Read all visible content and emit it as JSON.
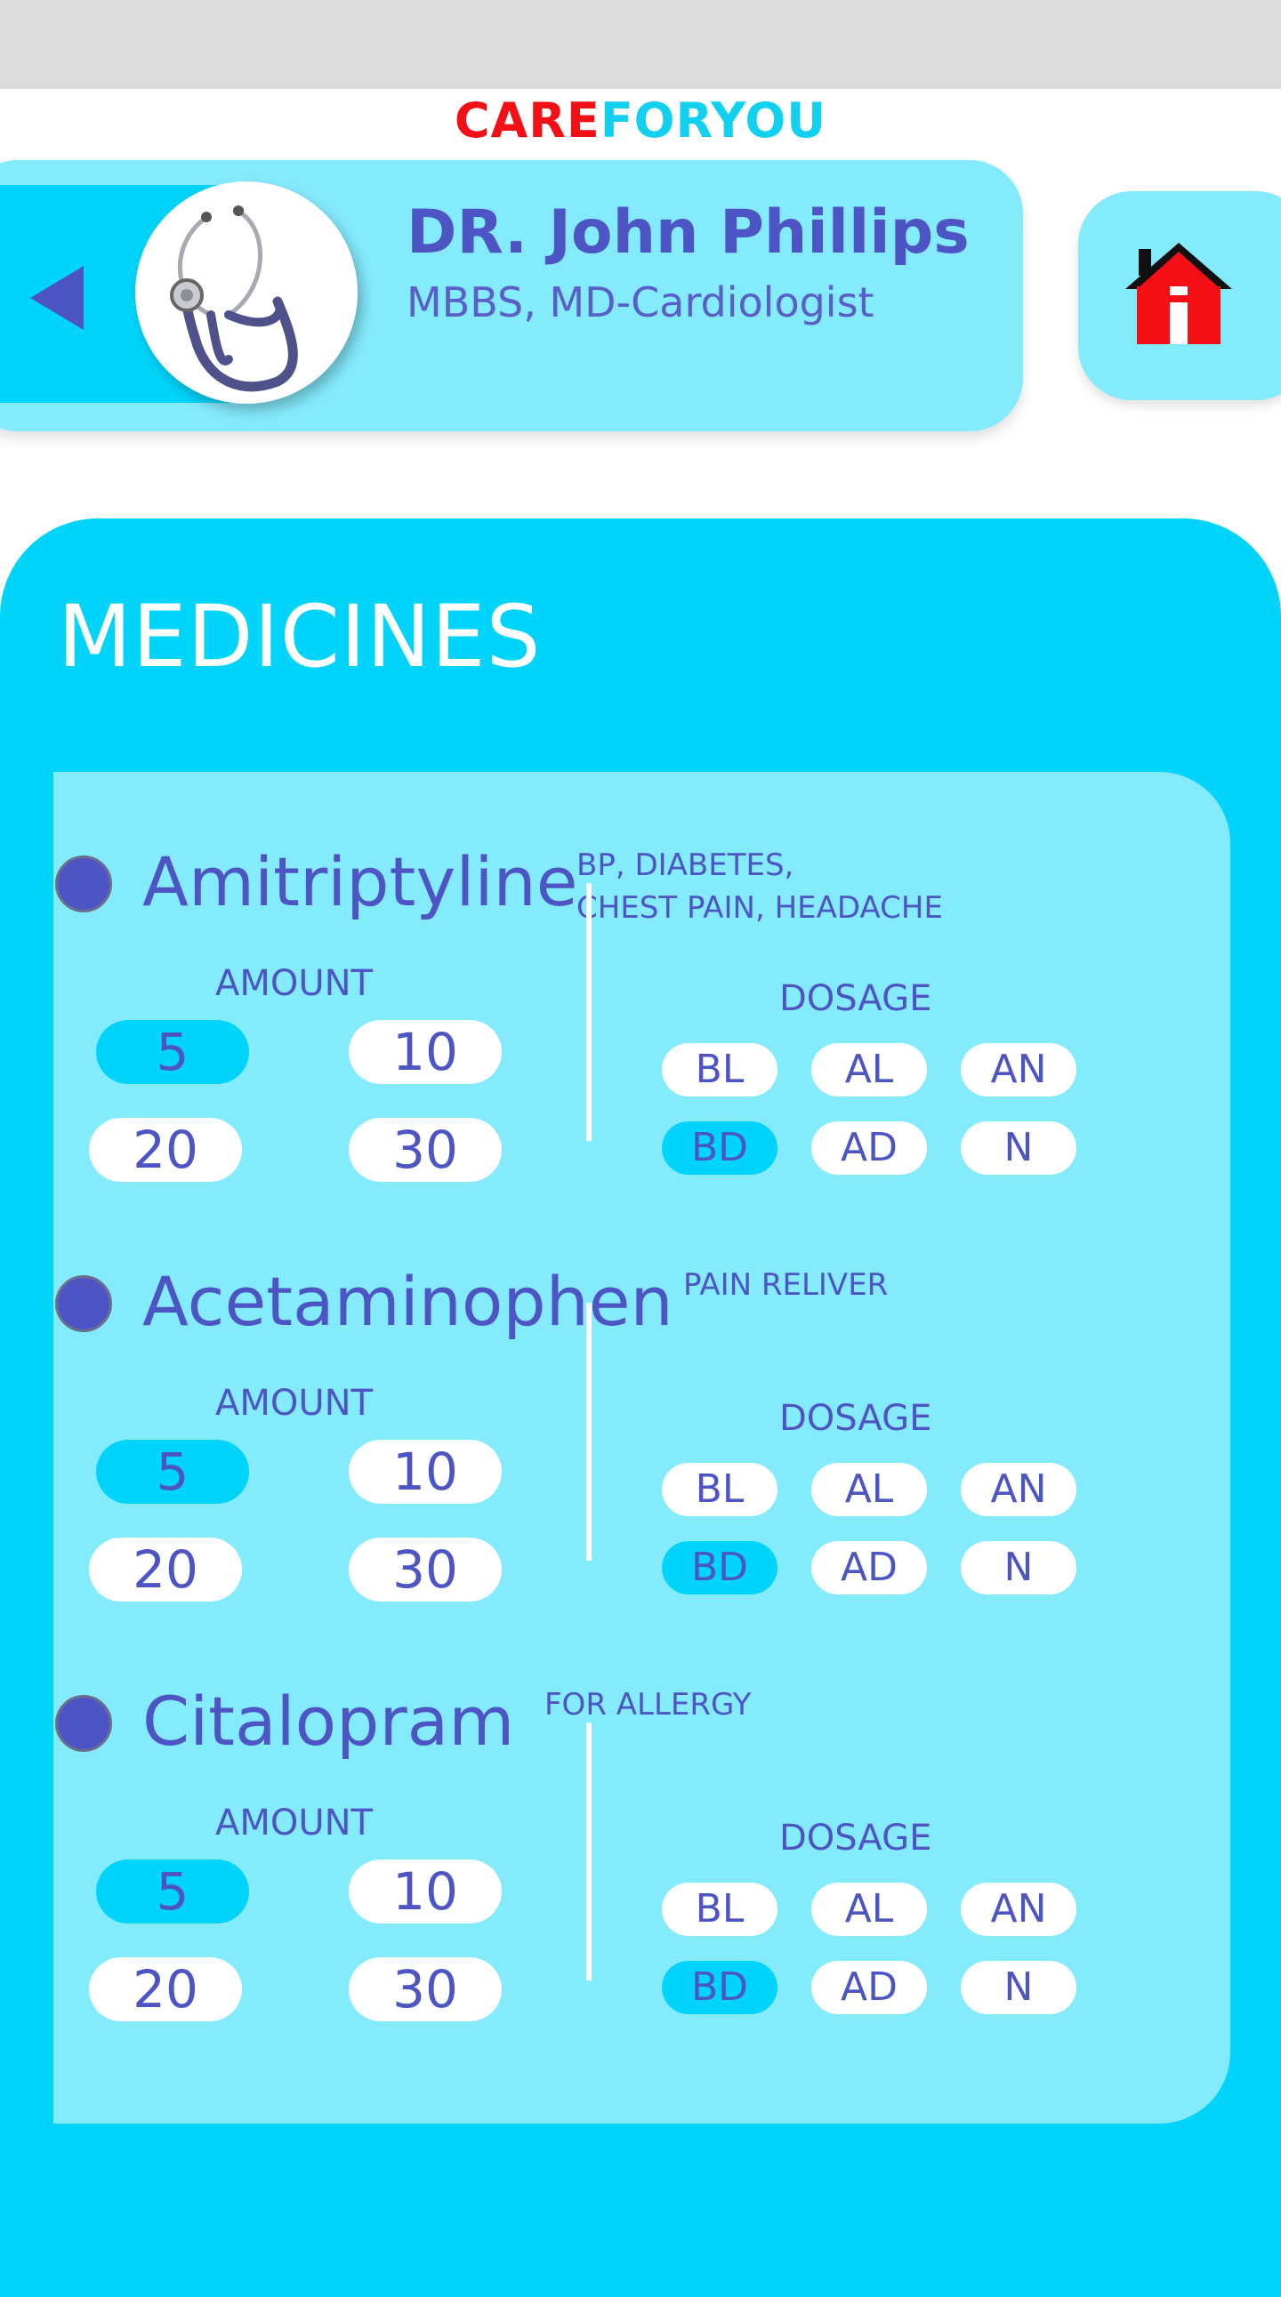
{
  "app": {
    "brand_part1": "CARE",
    "brand_part2": "FORYOU",
    "colors": {
      "brand_red": "#f20f15",
      "brand_cyan": "#12d0f0",
      "accent": "#00d4fa",
      "light_accent": "#84ebfd",
      "text": "#4d55c4"
    }
  },
  "header": {
    "doctor_name": "DR. John Phillips",
    "doctor_degree": "MBBS, MD-Cardiologist",
    "back_icon": "back-triangle-icon",
    "avatar_icon": "stethoscope-icon",
    "home_icon": "home-icon"
  },
  "medicines": {
    "title": "MEDICINES",
    "amount_label": "AMOUNT",
    "dosage_label": "DOSAGE",
    "items": [
      {
        "name": "Amitriptyline",
        "tags_line1": "BP, DIABETES,",
        "tags_line2": "CHEST PAIN, HEADACHE",
        "amounts": [
          "5",
          "10",
          "20",
          "30"
        ],
        "selected_amount": "5",
        "dosages": [
          "BL",
          "AL",
          "AN",
          "BD",
          "AD",
          "N"
        ],
        "selected_dosage": "BD"
      },
      {
        "name": "Acetaminophen",
        "tags_line1": "PAIN RELIVER",
        "tags_line2": "",
        "amounts": [
          "5",
          "10",
          "20",
          "30"
        ],
        "selected_amount": "5",
        "dosages": [
          "BL",
          "AL",
          "AN",
          "BD",
          "AD",
          "N"
        ],
        "selected_dosage": "BD"
      },
      {
        "name": "Citalopram",
        "tags_line1": "FOR ALLERGY",
        "tags_line2": "",
        "amounts": [
          "5",
          "10",
          "20",
          "30"
        ],
        "selected_amount": "5",
        "dosages": [
          "BL",
          "AL",
          "AN",
          "BD",
          "AD",
          "N"
        ],
        "selected_dosage": "BD"
      }
    ]
  }
}
